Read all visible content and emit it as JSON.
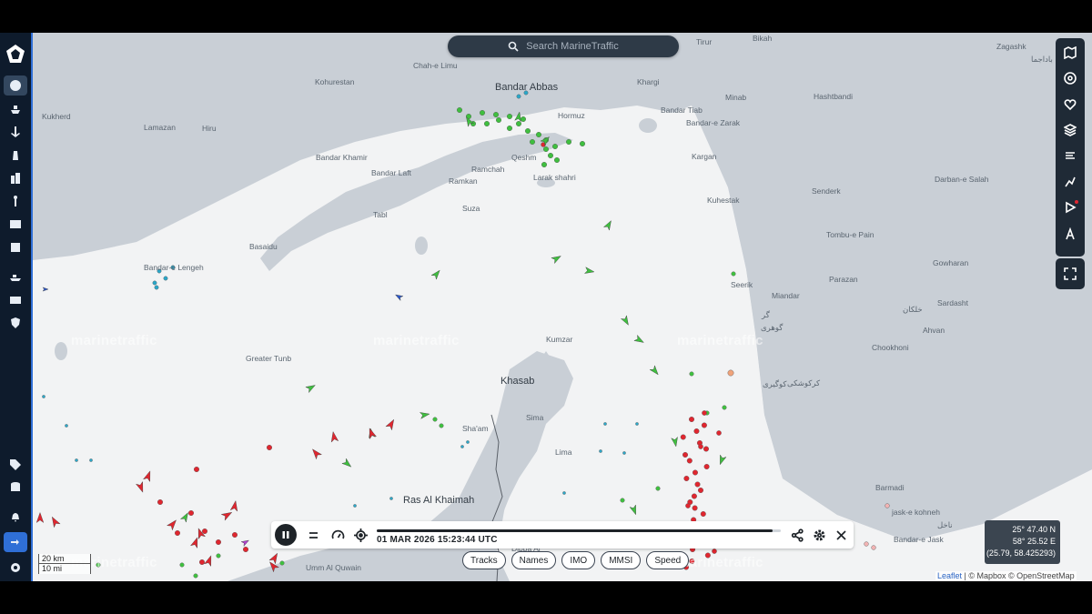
{
  "search": {
    "placeholder": "Search MarineTraffic"
  },
  "watermark": "marinetraffic",
  "places_major": [
    {
      "name": "Bandar Abbas"
    },
    {
      "name": "Khasab"
    },
    {
      "name": "Ras Al Khaimah"
    }
  ],
  "places_minor": [
    "Chah-e Limu",
    "Kohurestan",
    "Kukherd",
    "Lamazan",
    "Hiru",
    "Bandar Khamir",
    "Bandar Laft",
    "Tabl",
    "Basaidu",
    "Bandar-e Lengeh",
    "Ramchah",
    "Ramkan",
    "Qeshm",
    "Suza",
    "Larak shahri",
    "Hormuz",
    "Khargi",
    "Bandar Tiab",
    "Bandar-e Zarak",
    "Minab",
    "Hashtbandi",
    "Kargan",
    "Kuhestak",
    "Senderk",
    "Darban-e Salah",
    "Zagashk",
    "Tirur",
    "Bikah",
    "Tombu-e Pain",
    "Gowharan",
    "Parazan",
    "Seerik",
    "Miandar",
    "Sardasht",
    "Ahvan",
    "Chookhoni",
    "Kumzar",
    "Greater Tunb",
    "Sima",
    "Lima",
    "Sha'am",
    "Umm Al Quwain",
    "Dibba Al",
    "Barmadi",
    "jask-e kohneh",
    "Bandar-e Jask",
    "باداجما",
    "خلکان",
    "گوهری",
    "کوگیری",
    "گر",
    "کرکوشکی",
    "ناخل"
  ],
  "playback": {
    "datetime": "01 MAR 2026 15:23:44 UTC",
    "progress": 0.98
  },
  "chips": [
    "Tracks",
    "Names",
    "IMO",
    "MMSI",
    "Speed"
  ],
  "coords": {
    "lat": "25° 47.40 N",
    "lon": "58° 25.52 E",
    "decimal": "(25.79, 58.425293)"
  },
  "scale": {
    "km": "20 km",
    "mi": "10 mi"
  },
  "attribution": {
    "leaflet": "Leaflet",
    "rest": " | © Mapbox © OpenStreetMap"
  },
  "sidebar": {
    "items": [
      "globe",
      "vessel",
      "port",
      "lighthouse",
      "buildings",
      "antenna",
      "photos",
      "news",
      "fleet",
      "cargo",
      "shield",
      "tag",
      "database",
      "bell",
      "login",
      "settings"
    ]
  },
  "right_tools": [
    "map-layers",
    "overlays",
    "favorites",
    "layers",
    "weather",
    "routes",
    "play",
    "measure",
    "fullscreen"
  ],
  "colors": {
    "land": "#c9cfd6",
    "sea": "#f2f3f4",
    "sidebar": "#0e1b2c",
    "tanker": "#e0262f",
    "cargo": "#3fbf3f",
    "passenger": "#2aa7c9",
    "other": "#f0a37a"
  }
}
